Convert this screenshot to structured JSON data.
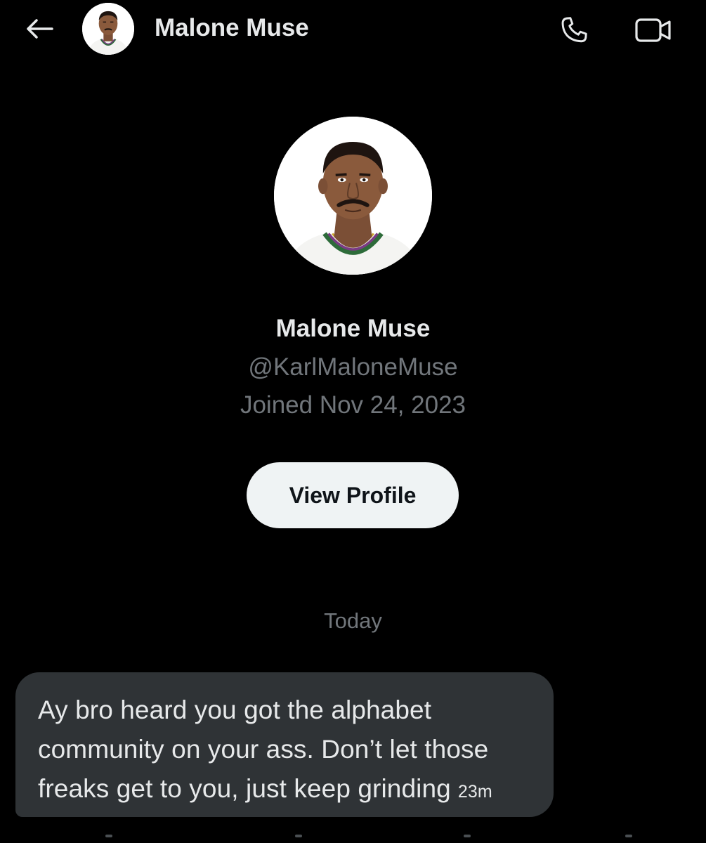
{
  "header": {
    "back_icon": "arrow-left-icon",
    "name": "Malone Muse",
    "call_icon": "phone-icon",
    "video_icon": "video-camera-icon"
  },
  "profile": {
    "name": "Malone Muse",
    "handle": "@KarlMaloneMuse",
    "joined": "Joined Nov 24, 2023",
    "view_profile_label": "View Profile"
  },
  "conversation": {
    "day_divider": "Today",
    "messages": [
      {
        "text": "Ay bro heard you got the alphabet community on your ass. Don’t let those freaks get to you, just keep grinding",
        "time": "23m"
      }
    ]
  },
  "colors": {
    "background": "#000000",
    "primary_text": "#e7e9ea",
    "secondary_text": "#71767b",
    "bubble": "#2f3336",
    "button_bg": "#eff3f4",
    "button_text": "#0f1419"
  }
}
